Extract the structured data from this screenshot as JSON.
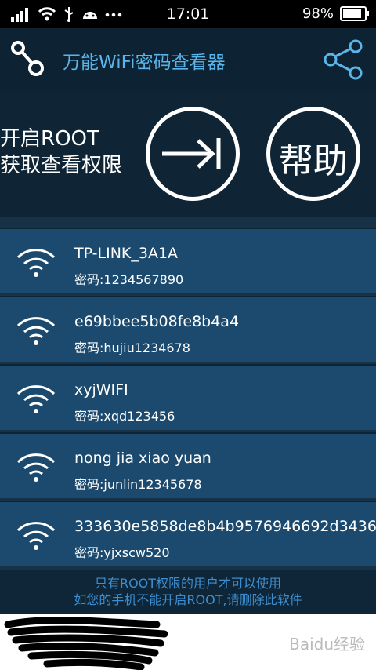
{
  "status_bar": {
    "time": "17:01",
    "battery": "98%"
  },
  "header": {
    "title": "万能WiFi密码查看器"
  },
  "root_panel": {
    "line1": "开启ROOT",
    "line2": "获取查看权限",
    "help_label": "帮助"
  },
  "wifi_list": [
    {
      "ssid": "TP-LINK_3A1A",
      "password": "密码:1234567890"
    },
    {
      "ssid": "e69bbee5b08fe8b4a4",
      "password": "密码:hujiu1234678"
    },
    {
      "ssid": "xyjWIFI",
      "password": "密码:xqd123456"
    },
    {
      "ssid": "nong jia xiao yuan",
      "password": "密码:junlin12345678"
    },
    {
      "ssid": "333630e5858de8b4b9576946692d3436",
      "password": "密码:yjxscw520"
    }
  ],
  "footer": {
    "line1": "只有ROOT权限的用户才可以使用",
    "line2": "如您的手机不能开启ROOT,请删除此软件"
  },
  "watermark": "Baidu经验",
  "colors": {
    "accent": "#5ab5ea",
    "list_row": "#1b4a6e",
    "panel": "#0f2536"
  }
}
